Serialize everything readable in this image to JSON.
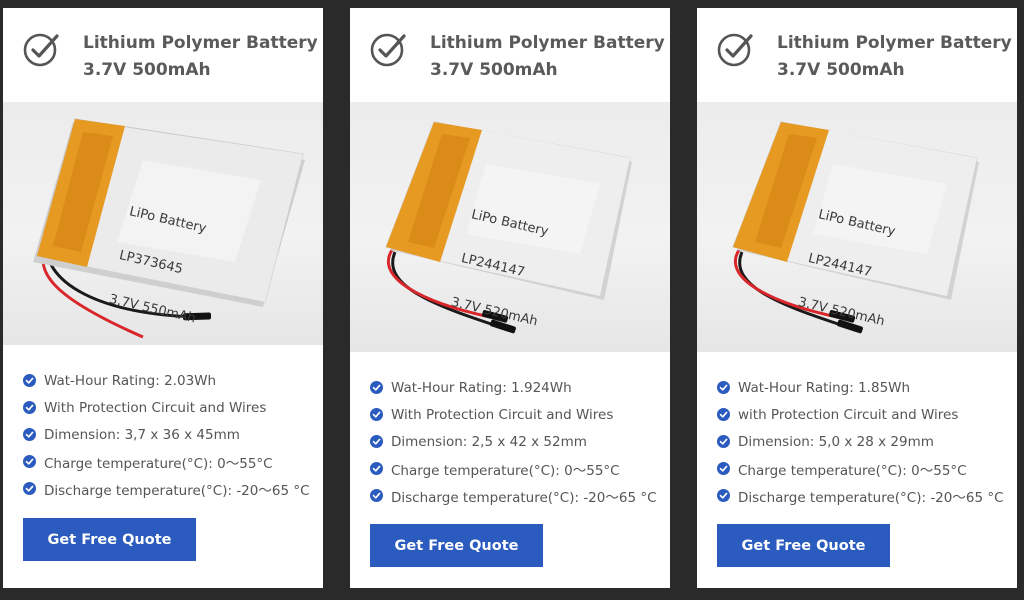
{
  "cards": [
    {
      "title_line1": "Lithium Polymer Battery",
      "title_line2": "3.7V 500mAh",
      "label_line1": "LiPo Battery",
      "label_line2": "LP373645",
      "label_line3": "3.7V 550mAh",
      "features": [
        "Wat-Hour Rating: 2.03Wh",
        "With Protection Circuit and Wires",
        "Dimension: 3,7 x 36 x 45mm",
        "Charge temperature(°C): 0～55°C",
        "Discharge temperature(°C): -20～65 °C"
      ],
      "button_label": "Get Free Quote"
    },
    {
      "title_line1": "Lithium Polymer Battery",
      "title_line2": "3.7V 500mAh",
      "label_line1": "LiPo Battery",
      "label_line2": "LP244147",
      "label_line3": "3.7V 520mAh",
      "features": [
        "Wat-Hour Rating: 1.924Wh",
        "With Protection Circuit and Wires",
        "Dimension: 2,5 x 42 x 52mm",
        "Charge temperature(°C): 0～55°C",
        "Discharge temperature(°C): -20～65 °C"
      ],
      "button_label": "Get Free Quote"
    },
    {
      "title_line1": "Lithium Polymer Battery",
      "title_line2": "3.7V 500mAh",
      "label_line1": "LiPo Battery",
      "label_line2": "LP244147",
      "label_line3": "3.7V 520mAh",
      "features": [
        "Wat-Hour Rating: 1.85Wh",
        "with Protection Circuit and Wires",
        "Dimension: 5,0 x 28 x 29mm",
        "Charge temperature(°C): 0～55°C",
        "Discharge temperature(°C): -20～65 °C"
      ],
      "button_label": "Get Free Quote"
    }
  ],
  "colors": {
    "accent": "#2b5bbf",
    "title": "#5a5a5a",
    "text": "#555555",
    "background": "#2a2a2a"
  },
  "icons": {
    "header": "check-badge-icon",
    "feature": "check-circle-icon"
  }
}
